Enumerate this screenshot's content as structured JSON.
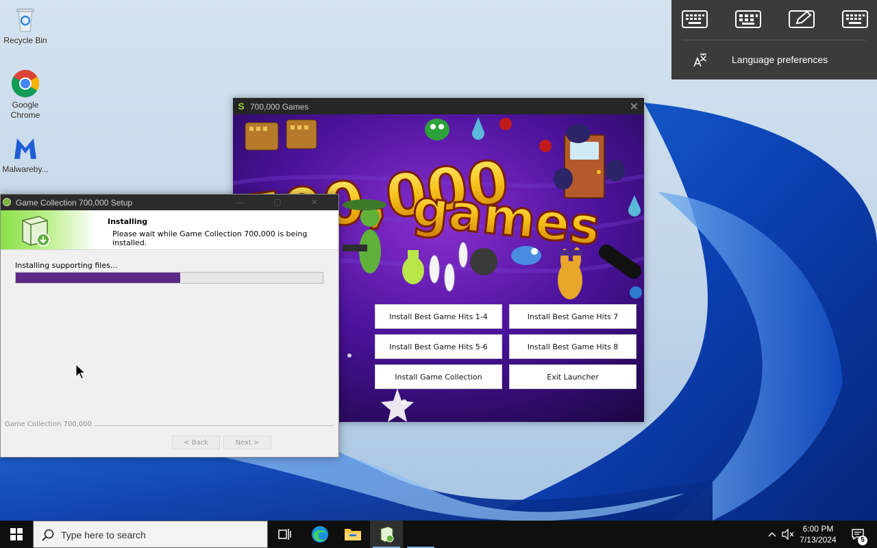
{
  "desktop": {
    "icons": [
      {
        "label": "Recycle Bin",
        "icon": "recycle-bin-icon"
      },
      {
        "label": "Google Chrome",
        "icon": "chrome-icon"
      },
      {
        "label": "Malwareby...",
        "icon": "malwarebytes-icon"
      }
    ]
  },
  "language_flyout": {
    "keyboards": [
      "keyboard-icon",
      "keyboard-icon",
      "pen-input-icon",
      "keyboard-icon"
    ],
    "preferences_label": "Language preferences"
  },
  "launcher": {
    "title": "700,000 Games",
    "logo_letter": "S",
    "banner_line1": "700,000",
    "banner_line2": "games",
    "buttons": [
      "Install Best Game Hits 1-4",
      "Install Best Game Hits 7",
      "Install Best Game Hits 5-6",
      "Install Best Game Hits 8",
      "Install Game Collection",
      "Exit Launcher"
    ]
  },
  "setup": {
    "title": "Game Collection 700,000 Setup",
    "header_title": "Installing",
    "header_subtitle": "Please wait while Game Collection 700,000 is being installed.",
    "status_text": "Installing supporting files...",
    "progress_fraction": 0.535,
    "brand": "Game Collection 700,000",
    "back_label": "< Back",
    "next_label": "Next >"
  },
  "taskbar": {
    "search_placeholder": "Type here to search",
    "time": "6:00 PM",
    "date": "7/13/2024",
    "notification_count": "5",
    "pinned": [
      "task-view-icon",
      "edge-icon",
      "file-explorer-icon",
      "installer-icon"
    ]
  },
  "colors": {
    "progress_fill": "#5b2a86",
    "launcher_bg": "#2a0c56",
    "taskbar_bg": "#0f0f10",
    "flyout_bg": "#3b3b3b"
  }
}
